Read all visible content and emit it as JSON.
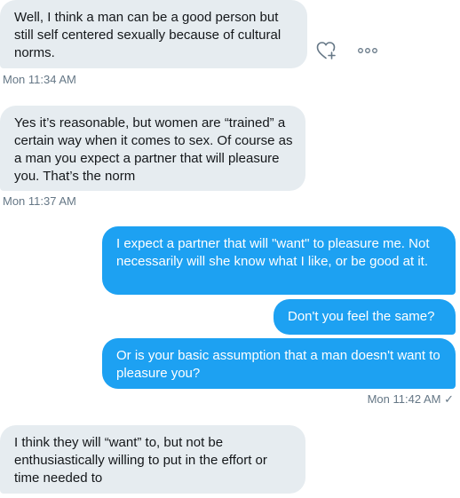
{
  "conversation": {
    "messages": [
      {
        "text": "Well, I think a man can be a good person but still self centered sexually because of cultural norms."
      },
      {
        "text": "Yes it’s reasonable, but women are “trained” a certain way when it comes to sex. Of course as a man you expect a partner that will pleasure you. That’s the norm"
      },
      {
        "text": "I expect a partner that will \"want\" to pleasure me. Not necessarily will she know what I like, or be good at it."
      },
      {
        "text": "Don't you feel the same?"
      },
      {
        "text": "Or is your basic assumption that a man doesn't want to pleasure you?"
      },
      {
        "text": "I think they will “want” to, but not be enthusiastically willing to put in the effort or time needed to"
      }
    ],
    "timestamps": [
      {
        "time": "Mon 11:34 AM"
      },
      {
        "time": "Mon 11:37 AM"
      },
      {
        "time": "Mon 11:42 AM",
        "status": "✓"
      }
    ]
  },
  "icons": {
    "react": "heart-plus-icon",
    "more": "more-options-icon",
    "sent": "checkmark-icon"
  },
  "colors": {
    "incoming_bubble": "#e6ecf0",
    "outgoing_bubble": "#1da1f2",
    "timestamp_text": "#657786"
  }
}
